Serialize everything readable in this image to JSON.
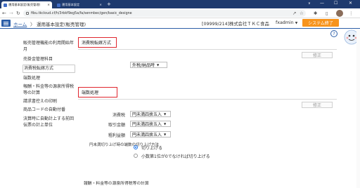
{
  "browser": {
    "tabs": [
      {
        "label": "運用基本設定(販売管理)",
        "close": "×",
        "active": true
      },
      {
        "label": "運用基本設定",
        "close": "×",
        "active": false
      }
    ],
    "new_tab": "+",
    "window_controls": {
      "menu": "∨",
      "minimize": "—",
      "maximize": "☐",
      "close": "✕"
    },
    "nav": {
      "back": "←",
      "forward": "→",
      "reload": "↻"
    },
    "url": "fibu.tkcloud.cf/h/3rbkf9eg5a/fa/senmbec/gen/basic_designe",
    "addr_icons": [
      "↗",
      "☆"
    ],
    "right_icons": {
      "extensions": "✱",
      "side_panel": "▯",
      "menu": "⋮"
    }
  },
  "header": {
    "home_link": "ホーム",
    "crumb_sep": "〉",
    "crumb_current": "運用基本設定(販売管理)",
    "company": "[09999/214]株式会社ＴＫＣ食品",
    "user": "fxadmin",
    "user_caret": "▼",
    "system_end": "システム終了",
    "help": "?"
  },
  "sidebar": {
    "items": [
      {
        "label": "販売管理機能の利用開始年月",
        "active": false
      },
      {
        "label": "売掛金管理科目",
        "active": false
      },
      {
        "label": "消費税転嫁方式",
        "active": true
      },
      {
        "label": "端数処理",
        "active": false
      },
      {
        "label": "報酬・料金等の源泉所得税等の計算",
        "active": false
      },
      {
        "label": "請求書控えの印刷",
        "active": false
      },
      {
        "label": "商品コードの自動付番",
        "active": false
      },
      {
        "label": "決算時に自動計上する前回伝票の計上単位",
        "active": false
      }
    ]
  },
  "main": {
    "tax_section": {
      "title": "消費税転嫁方式",
      "edit_label": "修正",
      "method_value": "外税/納品時",
      "caret": "▼"
    },
    "rounding_section": {
      "title": "端数処理",
      "edit_label": "修正",
      "fields": [
        {
          "label": "消費税",
          "value": "円未満四捨五入",
          "caret": "▼"
        },
        {
          "label": "取引金額",
          "value": "円未満四捨五入",
          "caret": "▼"
        },
        {
          "label": "粗利益額",
          "value": "円未満四捨五入",
          "caret": "▼"
        }
      ],
      "radio_label": "円未満切り上げ時の端数の切り上げ方法",
      "radio_options": [
        {
          "label": "切り上げる",
          "selected": true
        },
        {
          "label": "小数第1位が0でなければ切り上げる",
          "selected": false
        }
      ]
    },
    "next_section_title": "報酬・料金等の源泉所得税等の計算"
  }
}
